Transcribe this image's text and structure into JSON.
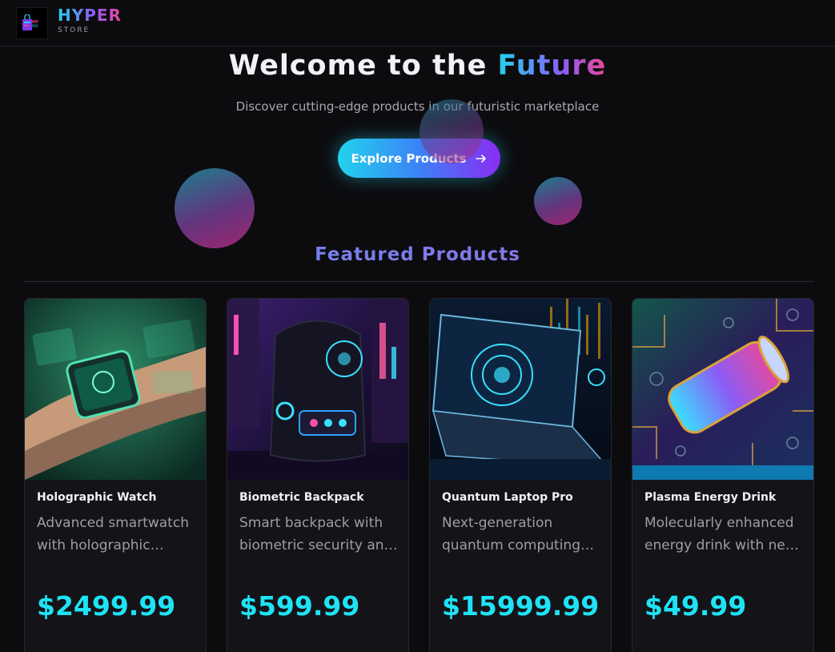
{
  "header": {
    "brand": "HYPER",
    "brand_sub": "STORE",
    "logo_icon": "shopping-bag-logo-icon"
  },
  "hero": {
    "title_plain": "Welcome to the ",
    "title_accent": "Future",
    "subtitle": "Discover cutting-edge products in our futuristic marketplace",
    "cta_label": "Explore Products",
    "cta_icon": "arrow-right-icon"
  },
  "featured": {
    "title": "Featured Products",
    "products": [
      {
        "name": "Holographic Watch",
        "description": "Advanced smartwatch with holographic display and AI assistant",
        "price": "$2499.99",
        "image_icon": "holographic-watch-image"
      },
      {
        "name": "Biometric Backpack",
        "description": "Smart backpack with biometric security and built-in charging",
        "price": "$599.99",
        "image_icon": "biometric-backpack-image"
      },
      {
        "name": "Quantum Laptop Pro",
        "description": "Next-generation quantum computing laptop for professionals",
        "price": "$15999.99",
        "image_icon": "quantum-laptop-image"
      },
      {
        "name": "Plasma Energy Drink",
        "description": "Molecularly enhanced energy drink with neon plasma boost",
        "price": "$49.99",
        "image_icon": "plasma-drink-image"
      }
    ]
  },
  "colors": {
    "background": "#0c0c0f",
    "accent_cyan": "#22d3ee",
    "accent_purple": "#8b5cf6",
    "accent_pink": "#ec4899",
    "price": "#1ee3f5"
  }
}
